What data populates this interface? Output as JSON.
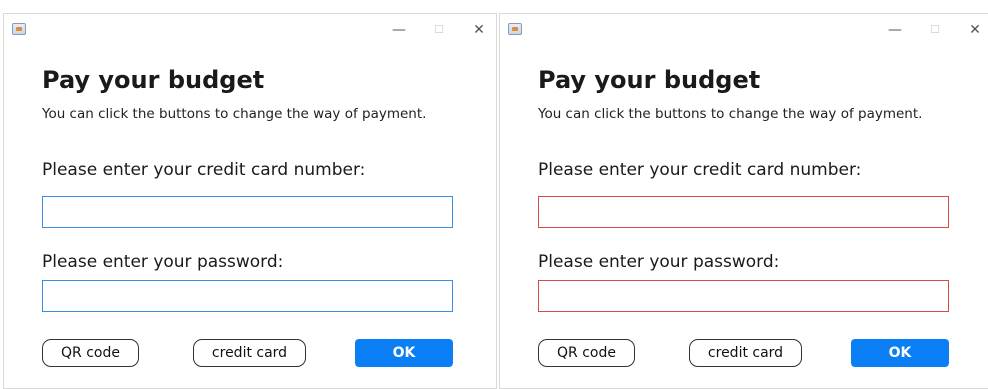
{
  "colors": {
    "accent": "#0a7ff5",
    "field_border_normal": "#3a8ee0",
    "field_border_error": "#d94848"
  },
  "icons": {
    "app": "java-app-icon",
    "minimize": "minimize-icon",
    "maximize": "maximize-icon",
    "close": "close-icon"
  },
  "windows": [
    {
      "heading": "Pay your budget",
      "subtitle": "You can click the buttons to change the way of payment.",
      "card_label": "Please enter your credit card number:",
      "card_value": "",
      "password_label": "Please enter your password:",
      "password_value": "",
      "qr_button": "QR code",
      "credit_button": "credit card",
      "ok_button": "OK",
      "state": "normal"
    },
    {
      "heading": "Pay your budget",
      "subtitle": "You can click the buttons to change the way of payment.",
      "card_label": "Please enter your credit card number:",
      "card_value": "",
      "password_label": "Please enter your password:",
      "password_value": "",
      "qr_button": "QR code",
      "credit_button": "credit card",
      "ok_button": "OK",
      "state": "error"
    }
  ]
}
